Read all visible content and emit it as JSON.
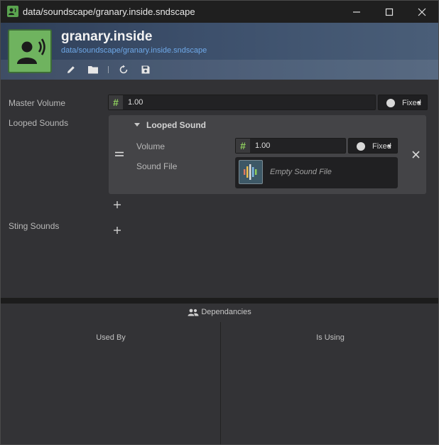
{
  "window": {
    "title": "data/soundscape/granary.inside.sndscape"
  },
  "header": {
    "asset_name": "granary.inside",
    "asset_path": "data/soundscape/granary.inside.sndscape",
    "tools": [
      "pencil-icon",
      "folder-icon",
      "refresh-icon",
      "save-icon"
    ]
  },
  "properties": {
    "master_volume": {
      "label": "Master Volume",
      "value": "1.00",
      "mode": "Fixed"
    },
    "looped_sounds": {
      "label": "Looped Sounds",
      "items": [
        {
          "header": "Looped Sound",
          "volume_label": "Volume",
          "volume_value": "1.00",
          "volume_mode": "Fixed",
          "sound_file_label": "Sound File",
          "sound_file_placeholder": "Empty Sound File"
        }
      ]
    },
    "sting_sounds": {
      "label": "Sting Sounds"
    }
  },
  "dependencies": {
    "title": "Dependancies",
    "used_by": "Used By",
    "is_using": "Is Using"
  },
  "colors": {
    "accent_green": "#6fb35f",
    "link_blue": "#6ea8e8",
    "hash_green": "#8fcf5e"
  }
}
